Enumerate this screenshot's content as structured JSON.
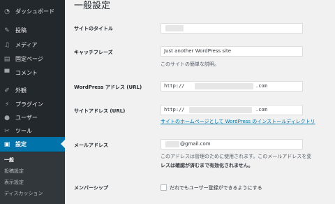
{
  "sidebar": {
    "dashboard": {
      "label": "ダッシュボード",
      "icon": "dashboard-icon"
    },
    "posts": {
      "label": "投稿",
      "icon": "pin-icon"
    },
    "media": {
      "label": "メディア",
      "icon": "media-icon"
    },
    "pages": {
      "label": "固定ページ",
      "icon": "page-icon"
    },
    "comments": {
      "label": "コメント",
      "icon": "comment-icon"
    },
    "appearance": {
      "label": "外観",
      "icon": "brush-icon"
    },
    "plugins": {
      "label": "プラグイン",
      "icon": "plugin-icon"
    },
    "users": {
      "label": "ユーザー",
      "icon": "user-icon"
    },
    "tools": {
      "label": "ツール",
      "icon": "wrench-icon"
    },
    "settings": {
      "label": "設定",
      "icon": "settings-icon"
    },
    "submenu": {
      "general": "一般",
      "writing": "投稿設定",
      "reading": "表示設定",
      "discussion": "ディスカッション"
    }
  },
  "page": {
    "title": "一般設定"
  },
  "form": {
    "site_title": {
      "label": "サイトのタイトル"
    },
    "tagline": {
      "label": "キャッチフレーズ",
      "value": "Just another WordPress site",
      "description": "このサイトの簡単な説明。"
    },
    "wp_address": {
      "label": "WordPress アドレス (URL)",
      "prefix": "http://",
      "suffix": ".com"
    },
    "site_address": {
      "label": "サイトアドレス (URL)",
      "prefix": "http://",
      "suffix": ".com",
      "link": "サイトのホームページとして WordPress のインストールディレクトリ"
    },
    "email": {
      "label": "メールアドレス",
      "value": "@gmail.com",
      "description_1": "このアドレスは管理のために使用されます。このメールアドレスを変",
      "description_2": "レスは確認が済むまで有効化されません。"
    },
    "membership": {
      "label": "メンバーシップ",
      "checkbox_label": "だれでもユーザー登録ができるようにする"
    }
  },
  "colors": {
    "sidebar_bg": "#23282d",
    "submenu_bg": "#32373c",
    "accent": "#0073aa",
    "content_bg": "#f1f1f1"
  }
}
